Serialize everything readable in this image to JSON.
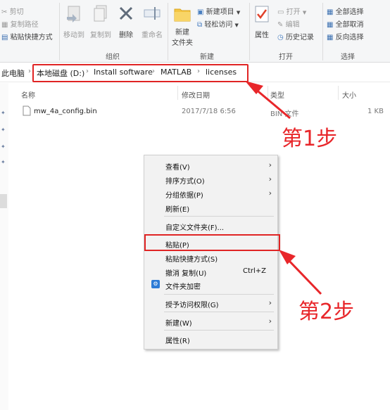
{
  "ribbon": {
    "clipboard": {
      "cut": "剪切",
      "copy_path": "复制路径",
      "paste_shortcut": "粘贴快捷方式",
      "group": ""
    },
    "organize": {
      "move_to": "移动到",
      "copy_to": "复制到",
      "delete": "删除",
      "rename": "重命名",
      "group": "组织"
    },
    "new": {
      "new_folder_line1": "新建",
      "new_folder_line2": "文件夹",
      "new_item": "新建项目",
      "easy_access": "轻松访问",
      "group": "新建"
    },
    "open": {
      "properties": "属性",
      "open": "打开",
      "edit": "编辑",
      "history": "历史记录",
      "group": "打开"
    },
    "select": {
      "select_all": "全部选择",
      "select_none": "全部取消",
      "invert": "反向选择",
      "group": "选择"
    }
  },
  "address": {
    "crumbs": [
      "此电脑",
      "本地磁盘 (D:)",
      "Install software",
      "MATLAB",
      "licenses"
    ]
  },
  "columns": {
    "name": "名称",
    "modified": "修改日期",
    "type": "类型",
    "size": "大小"
  },
  "files": [
    {
      "name": "mw_4a_config.bin",
      "modified": "2017/7/18 6:56",
      "type": "BIN 文件",
      "size": "1 KB"
    }
  ],
  "context_menu": {
    "view": "查看(V)",
    "sort": "排序方式(O)",
    "group": "分组依据(P)",
    "refresh": "刷新(E)",
    "customize": "自定义文件夹(F)...",
    "paste": "粘贴(P)",
    "paste_shortcut": "粘贴快捷方式(S)",
    "undo": "撤消 复制(U)",
    "undo_shortcut": "Ctrl+Z",
    "encrypt": "文件夹加密",
    "grant_access": "授予访问权限(G)",
    "new": "新建(W)",
    "properties": "属性(R)"
  },
  "annotations": {
    "step1": "第1步",
    "step2": "第2步",
    "color": "#e8262a"
  }
}
